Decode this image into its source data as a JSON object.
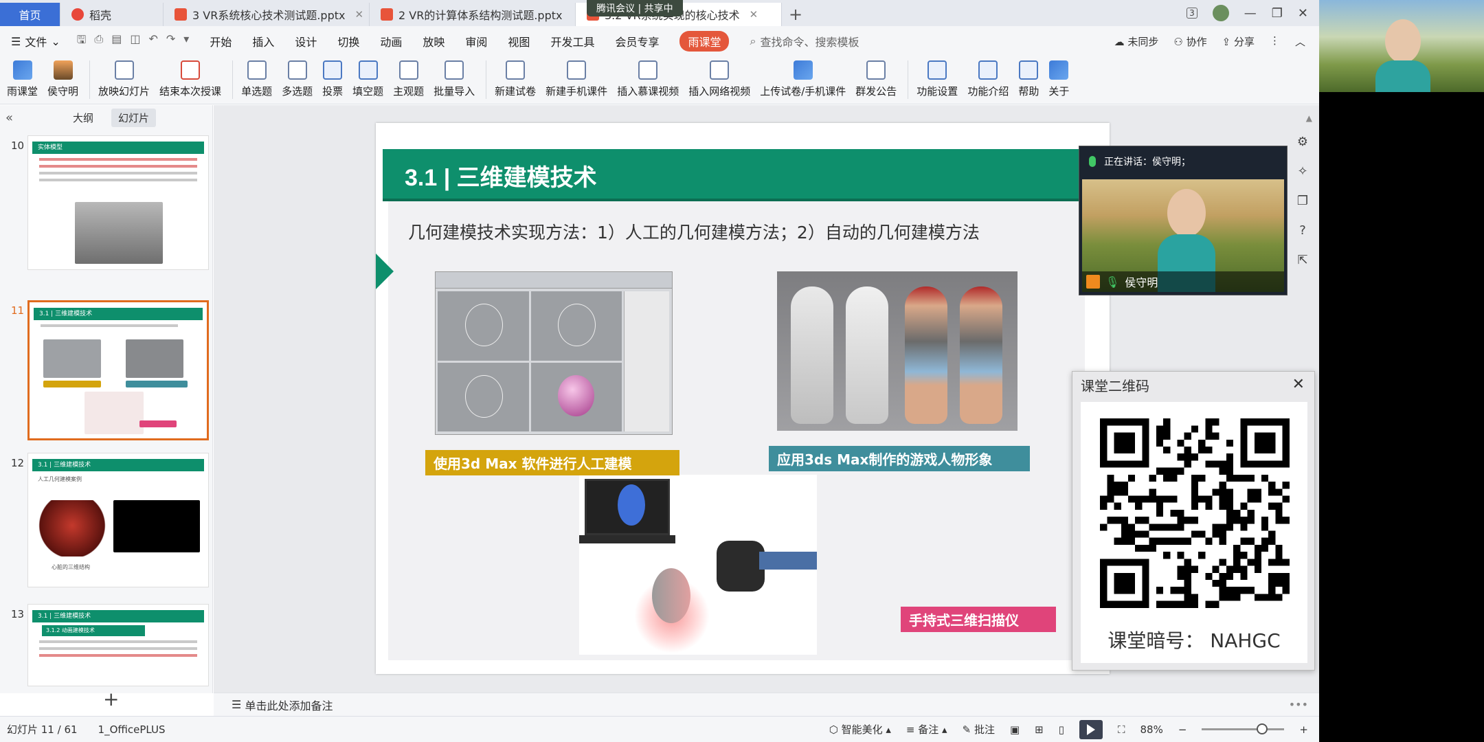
{
  "titlebar": {
    "tabs": [
      {
        "label": "首页",
        "kind": "home"
      },
      {
        "label": "稻壳",
        "color": "#e8473a"
      },
      {
        "label": "3 VR系统核心技术测试题.pptx",
        "color": "#e8543a"
      },
      {
        "label": "2 VR的计算体系结构测试题.pptx",
        "color": "#e8543a"
      },
      {
        "label": "3.2 VR系统实现的核心技术",
        "color": "#e8543a"
      }
    ],
    "meeting": "腾讯会议 | 共享中",
    "badge": "3"
  },
  "menubar": {
    "file": "文件",
    "items": [
      "开始",
      "插入",
      "设计",
      "切换",
      "动画",
      "放映",
      "审阅",
      "视图",
      "开发工具",
      "会员专享"
    ],
    "active": "雨课堂",
    "search": "查找命令、搜索模板",
    "right": [
      "未同步",
      "协作",
      "分享"
    ]
  },
  "ribbon": {
    "buttons": [
      "雨课堂",
      "侯守明",
      "放映幻灯片",
      "结束本次授课",
      "单选题",
      "多选题",
      "投票",
      "填空题",
      "主观题",
      "批量导入",
      "新建试卷",
      "新建手机课件",
      "插入慕课视频",
      "插入网络视频",
      "上传试卷/手机课件",
      "群发公告",
      "功能设置",
      "功能介绍",
      "帮助",
      "关于"
    ]
  },
  "leftpanel": {
    "tabs": [
      "大纲",
      "幻灯片"
    ],
    "slides": [
      {
        "num": "10",
        "title": "实体模型"
      },
      {
        "num": "11",
        "title": "3.1 | 三维建模技术"
      },
      {
        "num": "12",
        "title": "3.1 | 三维建模技术",
        "sub": "人工几何建模案例",
        "caption": "心脏的三维结构"
      },
      {
        "num": "13",
        "title": "3.1 | 三维建模技术",
        "sub": "3.1.2 动画建模技术"
      }
    ]
  },
  "slide": {
    "title": "3.1 | 三维建模技术",
    "subtitle": "几何建模技术实现方法：1）人工的几何建模方法；2）自动的几何建模方法",
    "caption1": "使用3d Max 软件进行人工建模",
    "caption2": "应用3ds Max制作的游戏人物形象",
    "caption3": "手持式三维扫描仪"
  },
  "speaker": {
    "label": "正在讲话：侯守明；",
    "name": "侯守明"
  },
  "qr": {
    "title": "课堂二维码",
    "code": "课堂暗号：  NAHGC"
  },
  "notes": {
    "placeholder": "单击此处添加备注"
  },
  "statusbar": {
    "slide": "幻灯片 11 / 61",
    "theme": "1_OfficePLUS",
    "beautify": "智能美化",
    "remarks": "备注",
    "comment": "批注",
    "zoom": "88%"
  },
  "colors": {
    "accent": "#0e8f6c",
    "wps_blue": "#3b6fd6",
    "yuketang": "#e4573b",
    "selected_thumb": "#e06b1e"
  }
}
